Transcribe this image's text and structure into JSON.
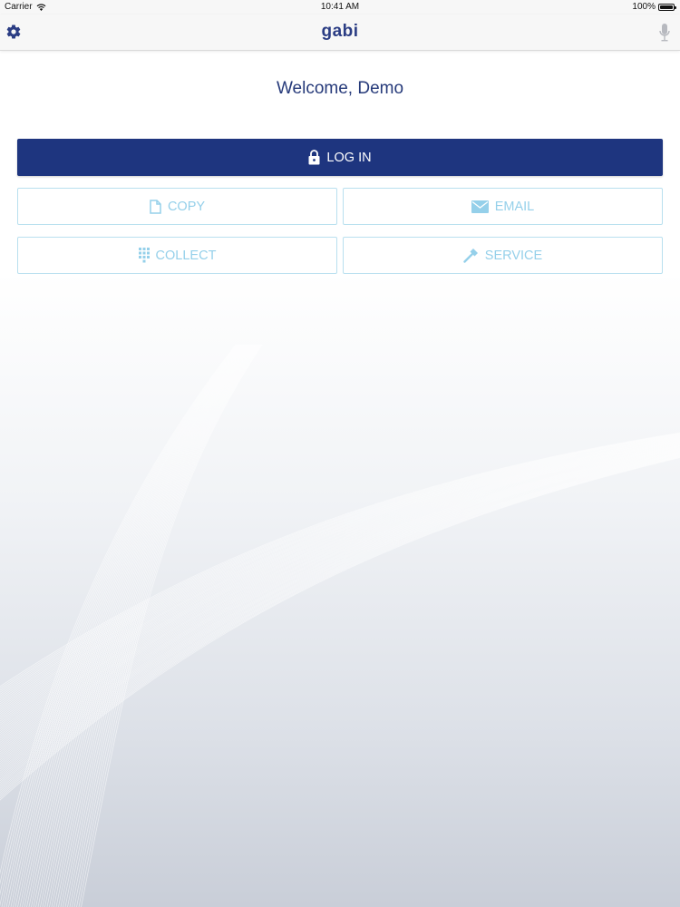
{
  "status_bar": {
    "carrier": "Carrier",
    "time": "10:41 AM",
    "battery": "100%"
  },
  "nav": {
    "title": "gabi",
    "left_icon": "gear-icon",
    "right_icon": "microphone-icon"
  },
  "welcome": "Welcome, Demo",
  "buttons": {
    "login": {
      "label": "LOG IN",
      "icon": "lock-icon"
    },
    "copy": {
      "label": "COPY",
      "icon": "document-icon"
    },
    "email": {
      "label": "EMAIL",
      "icon": "envelope-icon"
    },
    "collect": {
      "label": "COLLECT",
      "icon": "keypad-icon"
    },
    "service": {
      "label": "SERVICE",
      "icon": "hammer-icon"
    }
  },
  "colors": {
    "brand": "#1e357f",
    "accent_light": "#95d0ea",
    "title": "#2b3d84"
  }
}
